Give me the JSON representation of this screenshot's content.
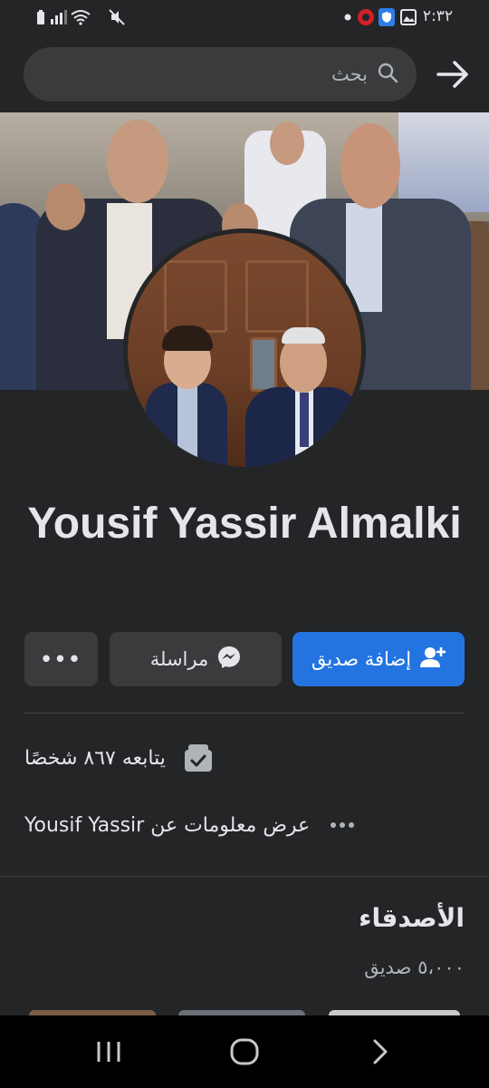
{
  "status_bar": {
    "time": "٢:٣٢"
  },
  "search": {
    "placeholder": "بحث"
  },
  "profile": {
    "name": "Yousif Yassir Almalki"
  },
  "actions": {
    "add_friend_label": "إضافة صديق",
    "message_label": "مراسلة",
    "more_label": "•••"
  },
  "info": {
    "followers_text": "يتابعه ٨٦٧ شخصًا",
    "about_text": "عرض معلومات عن Yousif Yassir"
  },
  "friends": {
    "title": "الأصدقاء",
    "count_text": "٥،٠٠٠ صديق"
  },
  "colors": {
    "background": "#242526",
    "primary": "#2374e1",
    "button_secondary": "#3a3b3c"
  }
}
